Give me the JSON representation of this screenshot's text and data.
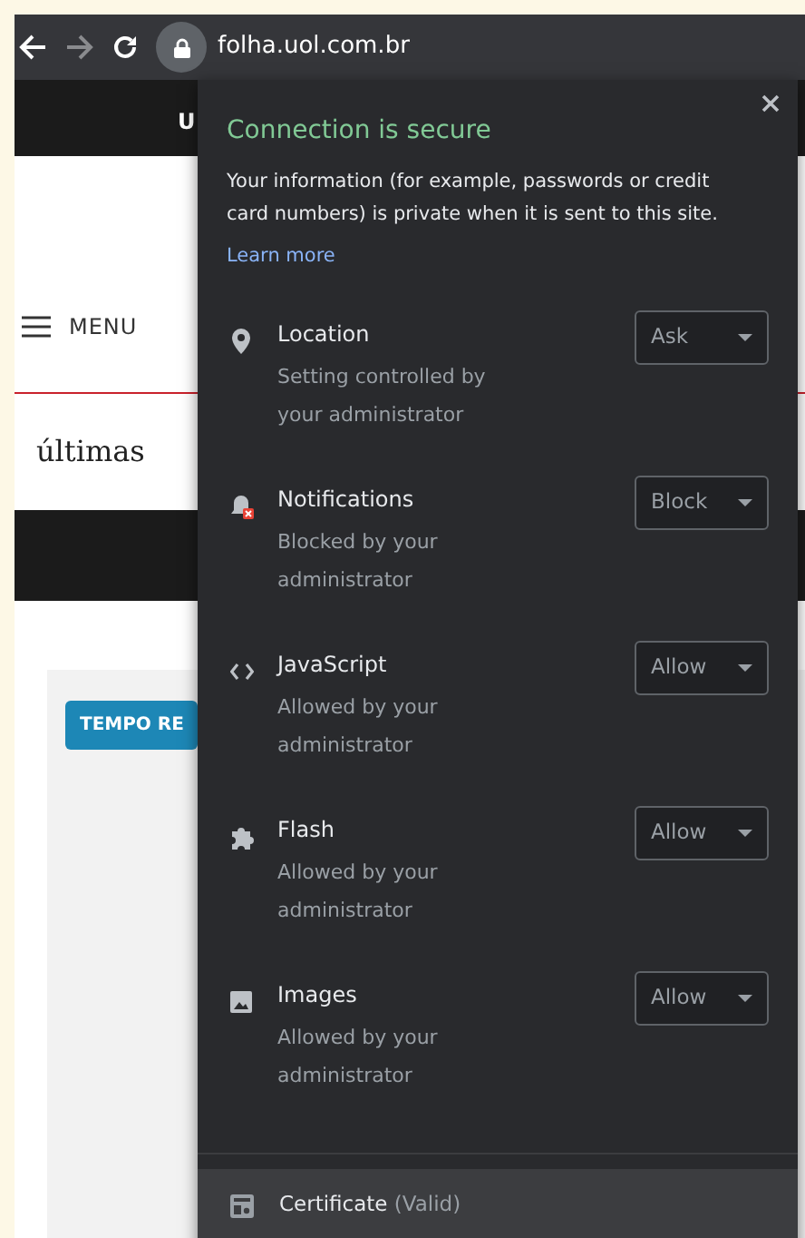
{
  "browser": {
    "url": "folha.uol.com.br"
  },
  "page": {
    "top_bar_text": "U",
    "menu_label": "MENU",
    "section_title": "últimas",
    "badge": "TEMPO RE"
  },
  "popup": {
    "title": "Connection is secure",
    "description": "Your information (for example, passwords or credit card numbers) is private when it is sent to this site.",
    "learn_more": "Learn more",
    "permissions": [
      {
        "kind": "location",
        "name": "Location",
        "note": "Setting controlled by your administrator",
        "value": "Ask"
      },
      {
        "kind": "notifications",
        "name": "Notifications",
        "note": "Blocked by your administrator",
        "value": "Block"
      },
      {
        "kind": "javascript",
        "name": "JavaScript",
        "note": "Allowed by your administrator",
        "value": "Allow"
      },
      {
        "kind": "flash",
        "name": "Flash",
        "note": "Allowed by your administrator",
        "value": "Allow"
      },
      {
        "kind": "images",
        "name": "Images",
        "note": "Allowed by your administrator",
        "value": "Allow"
      }
    ],
    "certificate": {
      "label": "Certificate",
      "status": "(Valid)"
    }
  }
}
